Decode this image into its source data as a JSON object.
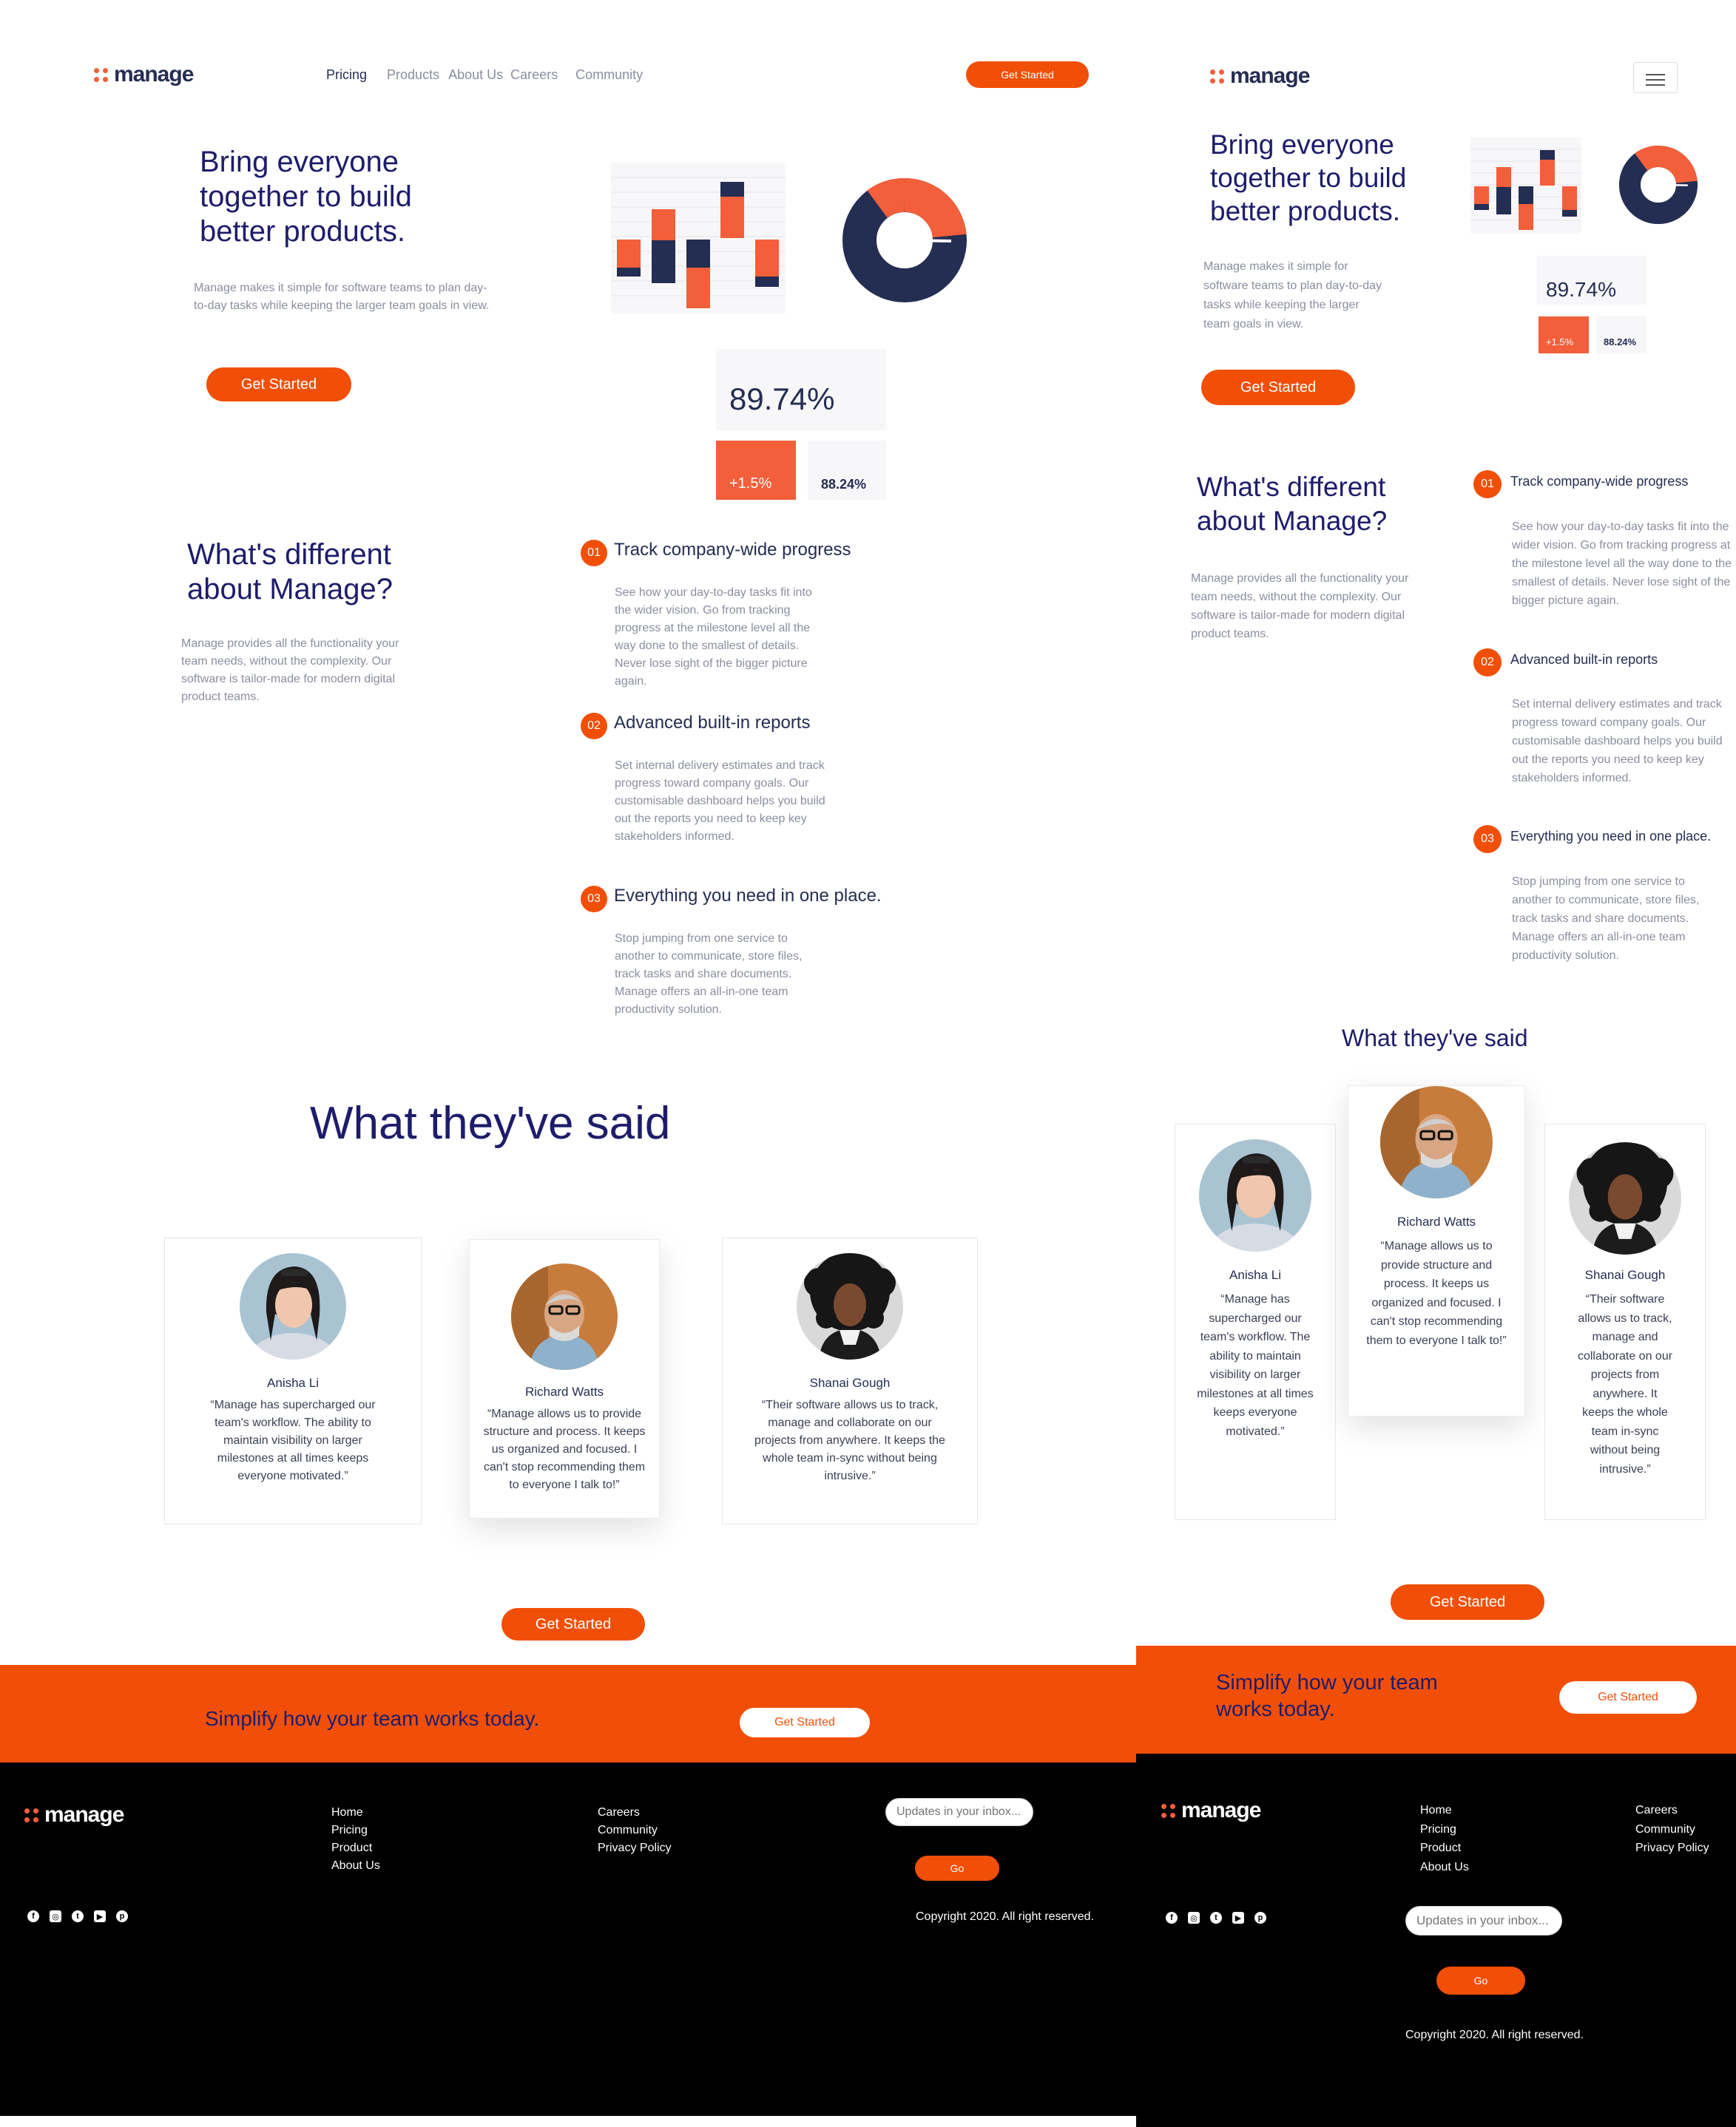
{
  "brand": {
    "name": "manage",
    "accent": "#f14f08",
    "navy": "#1e1c6b",
    "dark": "#242d52"
  },
  "nav": {
    "items": [
      "Pricing",
      "Products",
      "About Us",
      "Careers",
      "Community"
    ],
    "cta": "Get Started"
  },
  "hero": {
    "title_line1": "Bring everyone",
    "title_line2": "together to build",
    "title_line3": "better products.",
    "body": "Manage makes it simple for software teams to plan day-to-day tasks while keeping the larger team goals in view.",
    "cta": "Get Started",
    "stat_main": "89.74%",
    "stat_change": "+1.5%",
    "stat_secondary": "88.24%"
  },
  "different": {
    "title_line1": "What's different",
    "title_line2": "about Manage?",
    "body": "Manage provides all the functionality your team needs, without the complexity. Our software is tailor-made for modern digital product teams.",
    "features": [
      {
        "num": "01",
        "title": "Track company-wide progress",
        "body": "See how your day-to-day tasks fit into the wider vision. Go from tracking progress at the milestone level all the way done to the smallest of details. Never lose sight of the bigger picture again."
      },
      {
        "num": "02",
        "title": "Advanced built-in reports",
        "body": "Set internal delivery estimates and track progress toward company goals. Our customisable dashboard helps you build out the reports you need to keep key stakeholders informed."
      },
      {
        "num": "03",
        "title": "Everything you need in one place.",
        "body": "Stop jumping from one service to another to communicate, store files, track tasks and share documents. Manage offers an all-in-one team productivity solution."
      }
    ]
  },
  "testimonials": {
    "title": "What they've said",
    "items": [
      {
        "name": "Anisha Li",
        "quote": "“Manage has supercharged our team's workflow. The ability to maintain visibility on larger milestones at all times keeps everyone motivated.”"
      },
      {
        "name": "Richard Watts",
        "quote": "“Manage allows us to provide structure and process. It keeps us organized and focused. I can't stop recommending them to everyone I talk to!”"
      },
      {
        "name": "Shanai Gough",
        "quote": "“Their software allows us to track, manage and collaborate on our projects from anywhere. It keeps the whole team in-sync without being intrusive.”"
      }
    ],
    "cta": "Get Started"
  },
  "banner": {
    "text": "Simplify how your team works today.",
    "text_line1": "Simplify how your team",
    "text_line2": "works today.",
    "cta": "Get Started"
  },
  "footer": {
    "col1": [
      "Home",
      "Pricing",
      "Product",
      "About Us"
    ],
    "col2": [
      "Careers",
      "Community",
      "Privacy Policy"
    ],
    "input_placeholder": "Updates in your inbox...",
    "go": "Go",
    "copyright": "Copyright 2020. All right reserved.",
    "social_icons": [
      "facebook-icon",
      "instagram-icon",
      "twitter-icon",
      "youtube-icon",
      "pinterest-icon"
    ]
  }
}
